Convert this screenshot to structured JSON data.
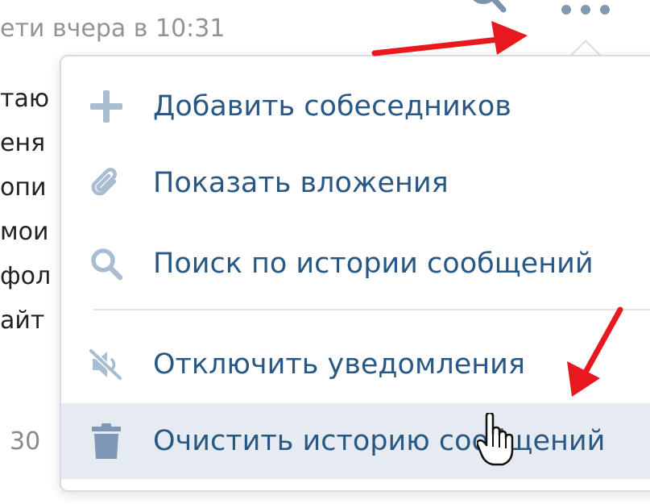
{
  "header": {
    "status_text": "ети вчера в 10:31"
  },
  "message_fragments": [
    "таю",
    "еня",
    "опи",
    "мои",
    "фол",
    "айт"
  ],
  "date_fragment": "30",
  "menu": {
    "items": [
      {
        "label": "Добавить собеседников",
        "icon": "plus-icon"
      },
      {
        "label": "Показать вложения",
        "icon": "paperclip-icon"
      },
      {
        "label": "Поиск по истории сообщений",
        "icon": "search-icon"
      },
      {
        "label": "Отключить уведомления",
        "icon": "bell-muted-icon"
      },
      {
        "label": "Очистить историю сообщений",
        "icon": "trash-icon",
        "hovered": true
      }
    ]
  },
  "colors": {
    "menu_text": "#2a5885",
    "icon": "#a8bdd1",
    "hover_bg": "#e5ebf1",
    "annotation_arrow": "#e8191e"
  }
}
